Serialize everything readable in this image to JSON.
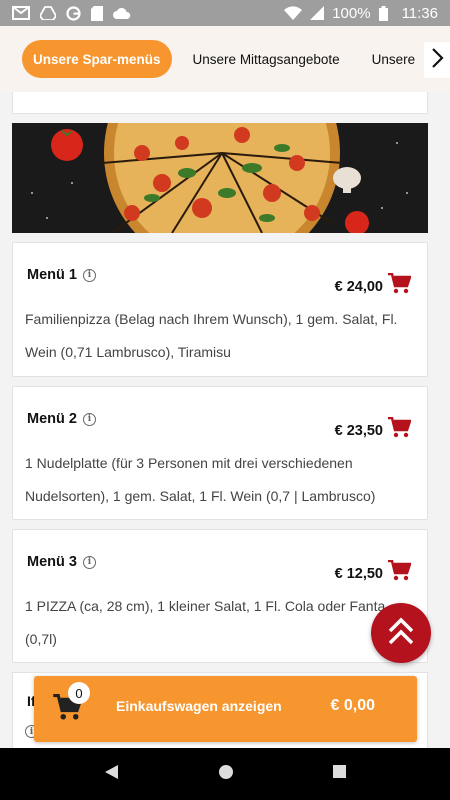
{
  "status_bar": {
    "battery": "100%",
    "time": "11:36",
    "icons": [
      "gmail-icon",
      "drive-icon",
      "google-icon",
      "sd-card-icon",
      "cloud-icon",
      "wifi-icon",
      "signal-icon",
      "battery-icon"
    ]
  },
  "tabs": {
    "items": [
      {
        "label": "Unsere Spar-menüs",
        "active": true
      },
      {
        "label": "Unsere Mittagsangebote",
        "active": false
      },
      {
        "label": "Unsere",
        "active": false
      }
    ],
    "next_icon": "chevron-right-icon"
  },
  "colors": {
    "accent": "#f7962e",
    "cart_red": "#b4121d",
    "status_bar": "#9e9e9e"
  },
  "menus": [
    {
      "title": "Menü 1",
      "price": "€ 24,00",
      "description": "Familienpizza (Belag nach Ihrem Wunsch), 1 gem. Salat, Fl. Wein (0,71 Lambrusco), Tiramisu"
    },
    {
      "title": "Menü 2",
      "price": "€ 23,50",
      "description": "1 Nudelplatte (für 3 Personen mit drei verschiedenen Nudelsorten), 1 gem. Salat, 1 Fl. Wein (0,7 | Lambrusco)"
    },
    {
      "title": "Menü 3",
      "price": "€ 12,50",
      "description": "1 PIZZA (ca, 28 cm), 1 kleiner Salat, 1 Fl. Cola oder Fanta (0,7l)"
    }
  ],
  "partial_card": {
    "title": "If"
  },
  "cart": {
    "count": "0",
    "label": "Einkaufswagen anzeigen",
    "total": "€ 0,00"
  }
}
